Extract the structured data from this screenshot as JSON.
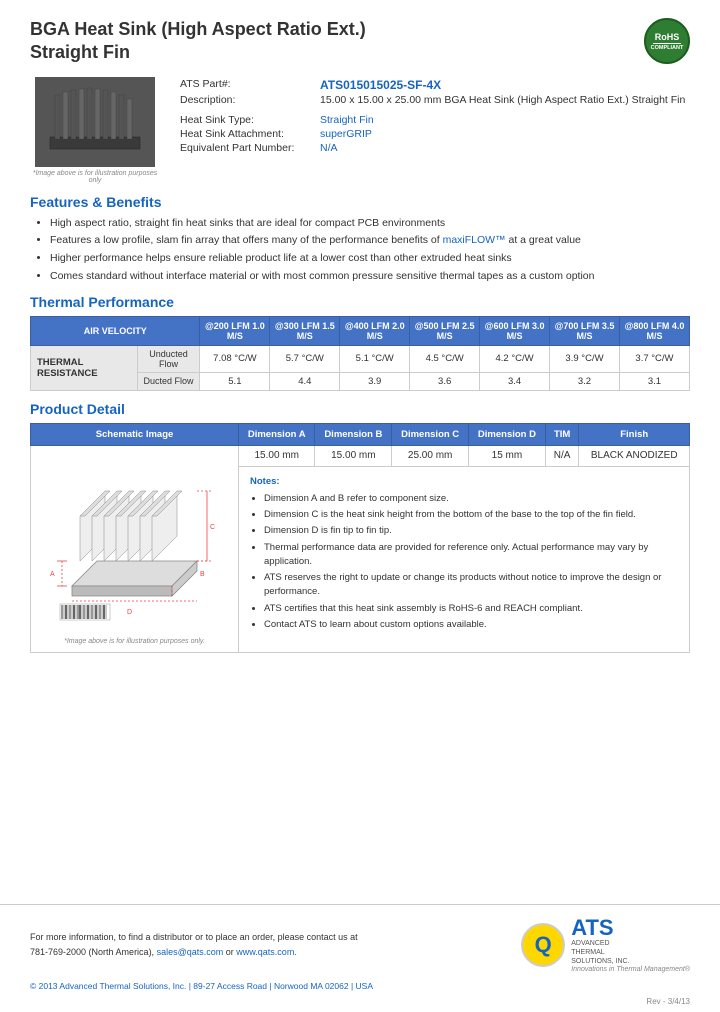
{
  "header": {
    "title_line1": "BGA Heat Sink (High Aspect Ratio Ext.)",
    "title_line2": "Straight Fin",
    "rohs": "RoHS",
    "compliant": "COMPLIANT"
  },
  "part_info": {
    "ats_part_label": "ATS Part#:",
    "ats_part_value": "ATS015015025-SF-4X",
    "description_label": "Description:",
    "description_value": "15.00 x 15.00 x 25.00 mm  BGA Heat Sink (High Aspect Ratio Ext.) Straight Fin",
    "heat_sink_type_label": "Heat Sink Type:",
    "heat_sink_type_value": "Straight Fin",
    "attachment_label": "Heat Sink Attachment:",
    "attachment_value": "superGRIP",
    "equiv_part_label": "Equivalent Part Number:",
    "equiv_part_value": "N/A",
    "image_caption": "*Image above is for illustration purposes only"
  },
  "features": {
    "heading": "Features & Benefits",
    "items": [
      "High aspect ratio, straight fin heat sinks that are ideal for compact PCB environments",
      "Features a low profile, slam fin array that offers many of the performance benefits of maxiFLOW™ at a great value",
      "Higher performance helps ensure reliable product life at a lower cost than other extruded heat sinks",
      "Comes standard without interface material or with most common pressure sensitive thermal tapes as a custom option"
    ]
  },
  "thermal_performance": {
    "heading": "Thermal Performance",
    "col_headers": [
      "AIR VELOCITY",
      "@200 LFM 1.0 M/S",
      "@300 LFM 1.5 M/S",
      "@400 LFM 2.0 M/S",
      "@500 LFM 2.5 M/S",
      "@600 LFM 3.0 M/S",
      "@700 LFM 3.5 M/S",
      "@800 LFM 4.0 M/S"
    ],
    "row_label": "THERMAL RESISTANCE",
    "rows": [
      {
        "label": "Unducted Flow",
        "values": [
          "7.08 °C/W",
          "5.7 °C/W",
          "5.1 °C/W",
          "4.5 °C/W",
          "4.2 °C/W",
          "3.9 °C/W",
          "3.7 °C/W"
        ]
      },
      {
        "label": "Ducted Flow",
        "values": [
          "5.1",
          "4.4",
          "3.9",
          "3.6",
          "3.4",
          "3.2",
          "3.1"
        ]
      }
    ]
  },
  "product_detail": {
    "heading": "Product Detail",
    "schematic_col": "Schematic Image",
    "col_headers": [
      "Dimension A",
      "Dimension B",
      "Dimension C",
      "Dimension D",
      "TIM",
      "Finish"
    ],
    "dim_values": [
      "15.00 mm",
      "15.00 mm",
      "25.00 mm",
      "15 mm",
      "N/A",
      "BLACK ANODIZED"
    ],
    "schematic_caption": "*Image above is for illustration purposes only.",
    "notes_title": "Notes:",
    "notes": [
      "Dimension A and B refer to component size.",
      "Dimension C is the heat sink height from the bottom of the base to the top of the fin field.",
      "Dimension D is fin tip to fin tip.",
      "Thermal performance data are provided for reference only. Actual performance may vary by application.",
      "ATS reserves the right to update or change its products without notice to improve the design or performance.",
      "ATS certifies that this heat sink assembly is RoHS-6 and REACH compliant.",
      "Contact ATS to learn about custom options available."
    ]
  },
  "footer": {
    "contact_line1": "For more information, to find a distributor or to place an order, please contact us at",
    "contact_line2": "781-769-2000 (North America),",
    "email": "sales@qats.com",
    "contact_or": "or",
    "website": "www.qats.com.",
    "copyright": "© 2013 Advanced Thermal Solutions, Inc.  |  89-27 Access Road  |  Norwood MA  02062  |  USA",
    "revision": "Rev - 3/4/13",
    "ats_q": "Q",
    "ats_name": "ATS",
    "ats_full": "ADVANCED\nTHERMAL\nSOLUTIONS, INC.",
    "ats_tagline": "Innovations in Thermal Management®"
  }
}
